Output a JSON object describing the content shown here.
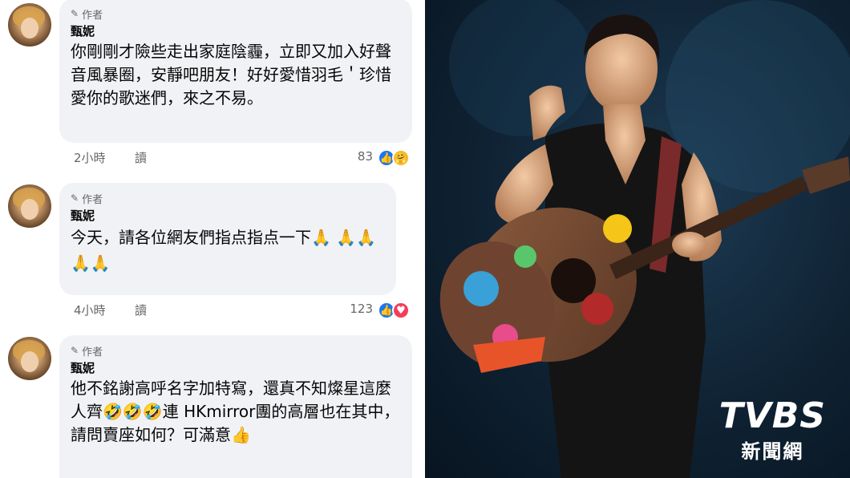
{
  "comments": [
    {
      "author_tag": "作者",
      "name": "甄妮",
      "text": "你剛剛才險些走出家庭陰霾，立即又加入好聲音風暴圈，安靜吧朋友！好好愛惜羽毛＇珍惜愛你的歌迷們，來之不易。",
      "time": "2小時",
      "read": "讀",
      "count": "83",
      "reactions": [
        "like",
        "care"
      ]
    },
    {
      "author_tag": "作者",
      "name": "甄妮",
      "text": "今天，請各位網友們指点指点一下🙏 🙏🙏🙏🙏",
      "time": "4小時",
      "read": "讀",
      "count": "123",
      "reactions": [
        "like",
        "love"
      ]
    },
    {
      "author_tag": "作者",
      "name": "甄妮",
      "text": "他不銘謝高呼名字加特寫，還真不知燦星這麼人齊🤣🤣🤣連 HKmirror團的高層也在其中，請問賣座如何？可滿意👍"
    }
  ],
  "watermark": {
    "logo": "TVBS",
    "sub": "新聞網"
  },
  "icons": {
    "author": "pencil-icon",
    "like": "thumbs-up-icon",
    "care": "care-icon",
    "love": "heart-icon"
  },
  "colors": {
    "bubble": "#f0f2f5",
    "like": "#1877f2",
    "love": "#f33e58",
    "care": "#f7b928"
  }
}
